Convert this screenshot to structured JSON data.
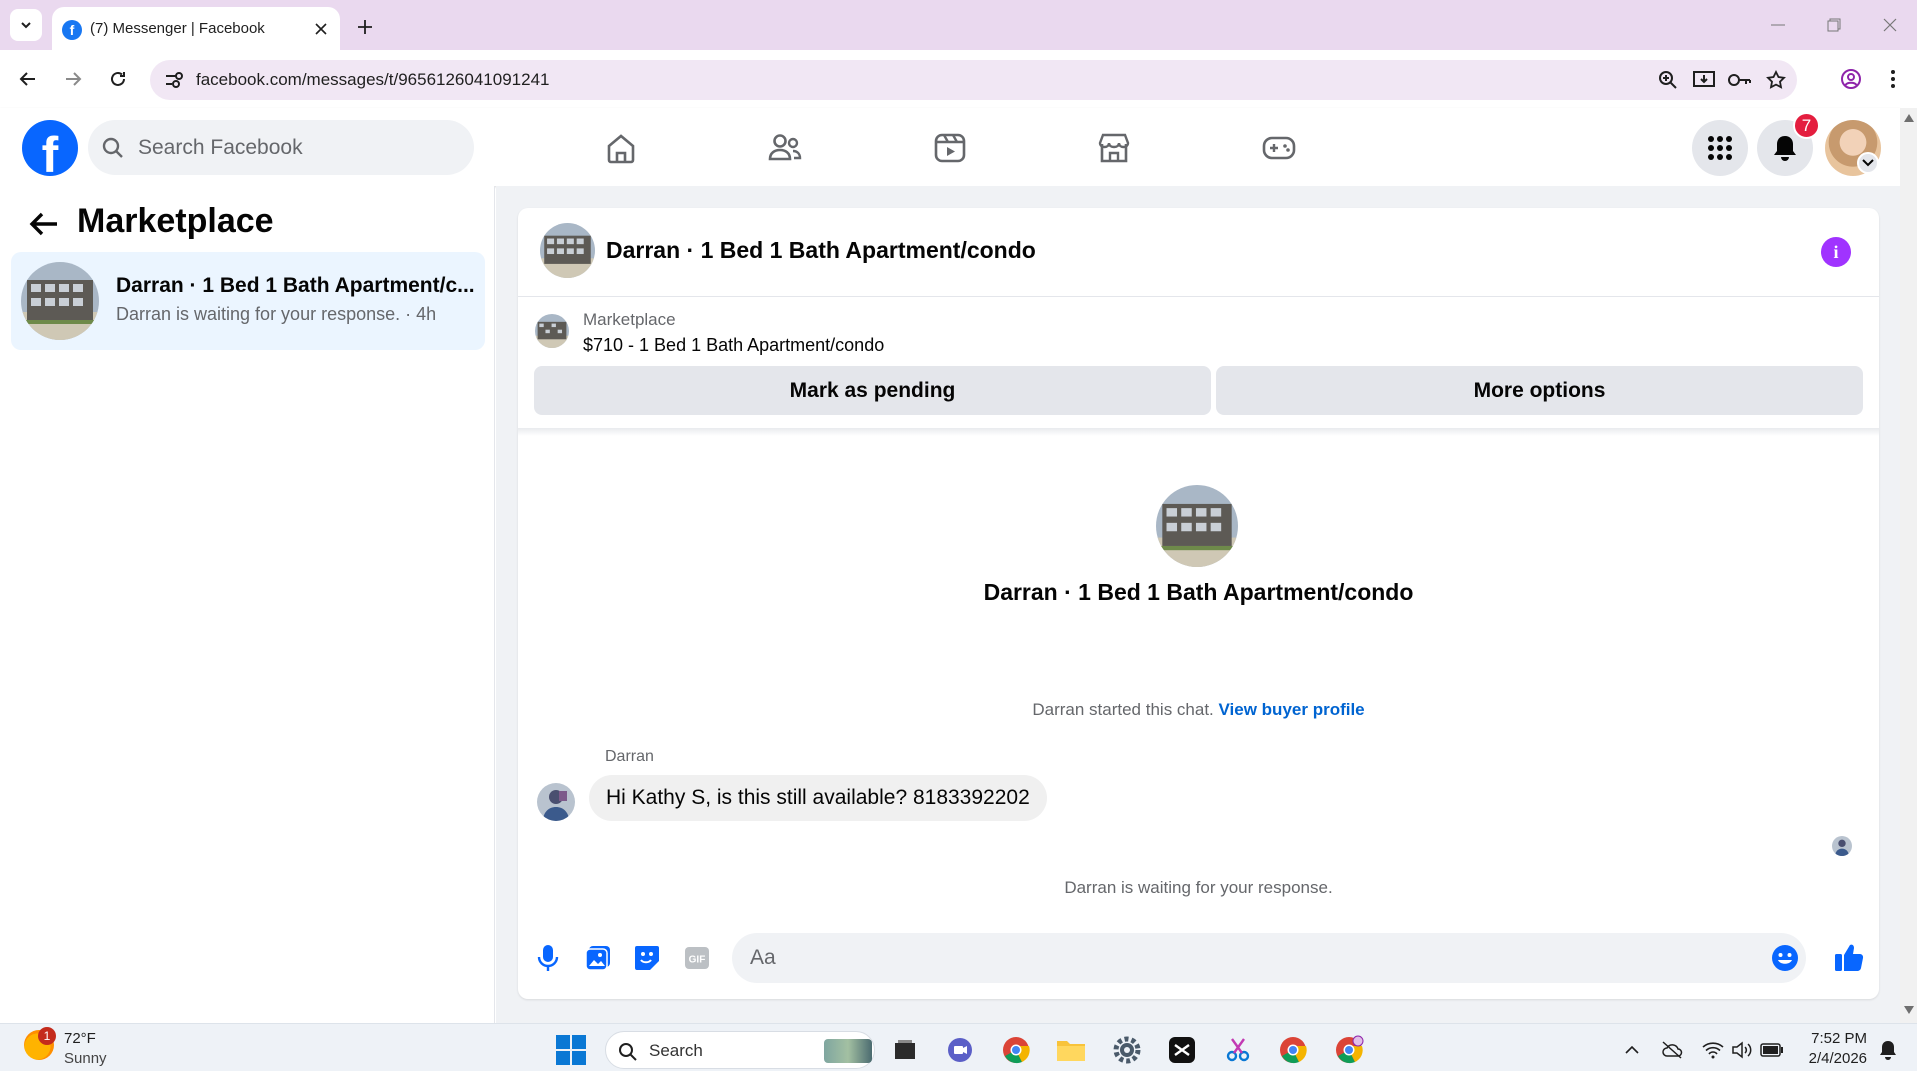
{
  "browser": {
    "tab_title": "(7) Messenger | Facebook",
    "url": "facebook.com/messages/t/9656126041091241"
  },
  "fb_header": {
    "search_placeholder": "Search Facebook",
    "notification_count": "7",
    "nav_tabs": [
      "home",
      "friends",
      "watch",
      "marketplace",
      "gaming"
    ]
  },
  "left_panel": {
    "title": "Marketplace",
    "conversations": [
      {
        "name": "Darran · 1 Bed 1 Bath Apartment/c...",
        "preview": "Darran is waiting for your response. · 4h"
      }
    ]
  },
  "chat": {
    "title": "Darran · 1 Bed 1 Bath Apartment/condo",
    "listing": {
      "label": "Marketplace",
      "title": "$710 - 1 Bed 1 Bath Apartment/condo"
    },
    "buttons": {
      "pending": "Mark as pending",
      "more": "More options"
    },
    "intro_name": "Darran · 1 Bed 1 Bath Apartment/condo",
    "started_text": "Darran started this chat.",
    "buyer_link": "View buyer profile",
    "messages": [
      {
        "sender": "Darran",
        "text": "Hi Kathy S, is this still available? 8183392202"
      }
    ],
    "waiting_text": "Darran is waiting for your response.",
    "composer_placeholder": "Aa"
  },
  "taskbar": {
    "weather_temp": "72°F",
    "weather_desc": "Sunny",
    "weather_badge": "1",
    "search_label": "Search",
    "time": "7:52 PM",
    "date": "2/4/2026"
  },
  "colors": {
    "fb_blue": "#0866ff",
    "selected_conversation": "#ebf5ff",
    "link_blue": "#0064d1",
    "badge_red": "#e41e3f",
    "info_purple": "#a033ff"
  }
}
